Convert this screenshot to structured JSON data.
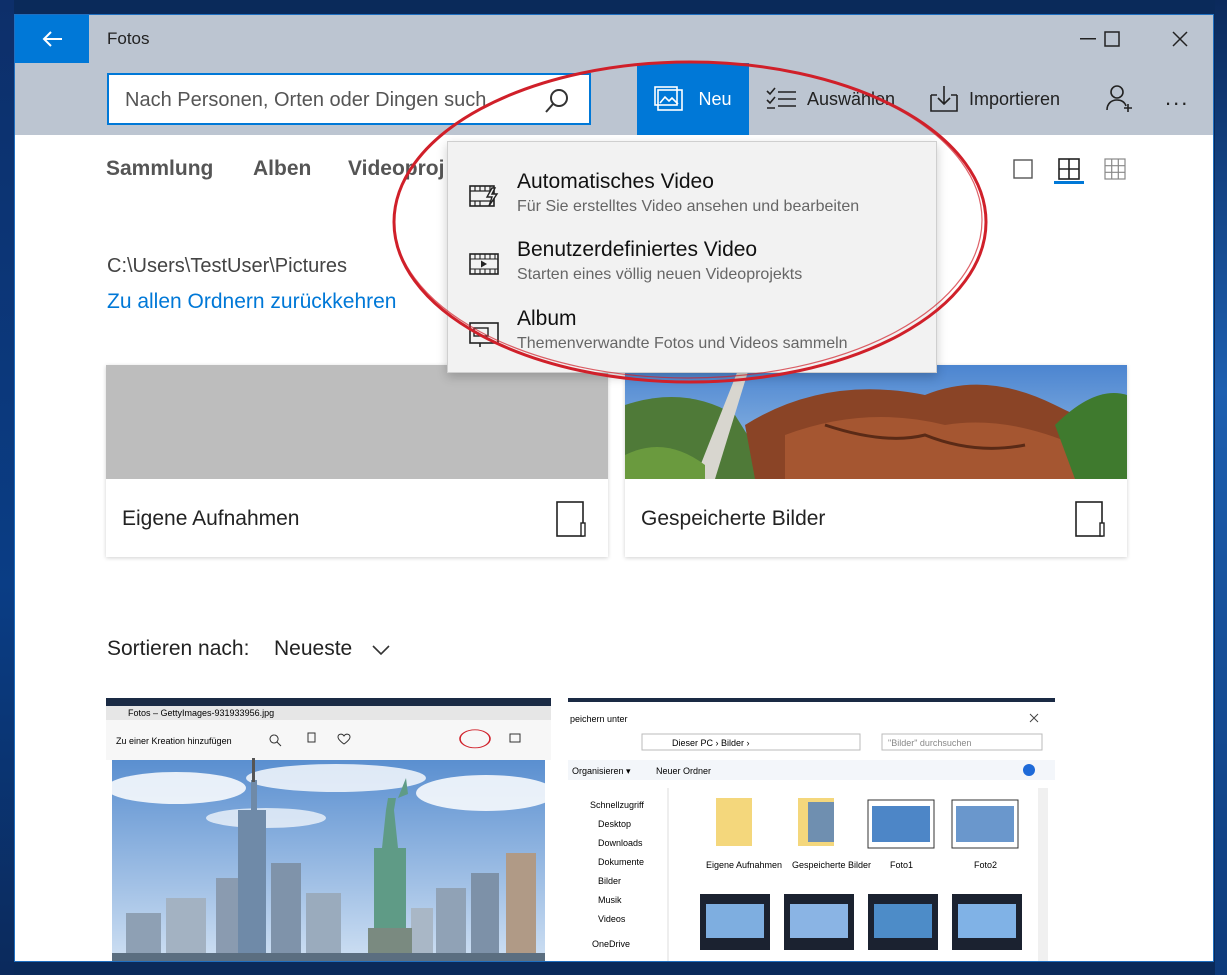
{
  "window": {
    "title": "Fotos"
  },
  "search": {
    "placeholder": "Nach Personen, Orten oder Dingen such"
  },
  "toolbar": {
    "new_label": "Neu",
    "select_label": "Auswählen",
    "import_label": "Importieren",
    "more_label": "..."
  },
  "nav": {
    "tabs": [
      "Sammlung",
      "Alben",
      "Videoproj"
    ]
  },
  "folder": {
    "path": "C:\\Users\\TestUser\\Pictures",
    "back_link": "Zu allen Ordnern zurückkehren"
  },
  "cards": [
    {
      "label": "Eigene Aufnahmen"
    },
    {
      "label": "Gespeicherte Bilder"
    }
  ],
  "sort": {
    "label": "Sortieren nach:",
    "value": "Neueste"
  },
  "menu": {
    "items": [
      {
        "title": "Automatisches Video",
        "subtitle": "Für Sie erstelltes Video ansehen und bearbeiten",
        "icon": "auto-video-icon"
      },
      {
        "title": "Benutzerdefiniertes Video",
        "subtitle": "Starten eines völlig neuen Videoprojekts",
        "icon": "custom-video-icon"
      },
      {
        "title": "Album",
        "subtitle": "Themenverwandte Fotos und Videos sammeln",
        "icon": "album-icon"
      }
    ]
  },
  "thumb1": {
    "title": "Fotos – GettyImages-931933956.jpg",
    "action": "Zu einer Kreation hinzufügen"
  },
  "thumb2": {
    "title": "peichern unter",
    "breadcrumb": "Dieser PC › Bilder ›",
    "search_placeholder": "\"Bilder\" durchsuchen",
    "organize": "Organisieren ▾",
    "new_folder": "Neuer Ordner",
    "tree": [
      "Schnellzugriff",
      "Desktop",
      "Downloads",
      "Dokumente",
      "Bilder",
      "Musik",
      "Videos",
      "OneDrive"
    ],
    "items": [
      "Eigene Aufnahmen",
      "Gespeicherte Bilder",
      "Foto1",
      "Foto2"
    ]
  },
  "colors": {
    "accent": "#0078d7",
    "chrome": "#bcc5d1",
    "annotation": "#d0202a"
  }
}
